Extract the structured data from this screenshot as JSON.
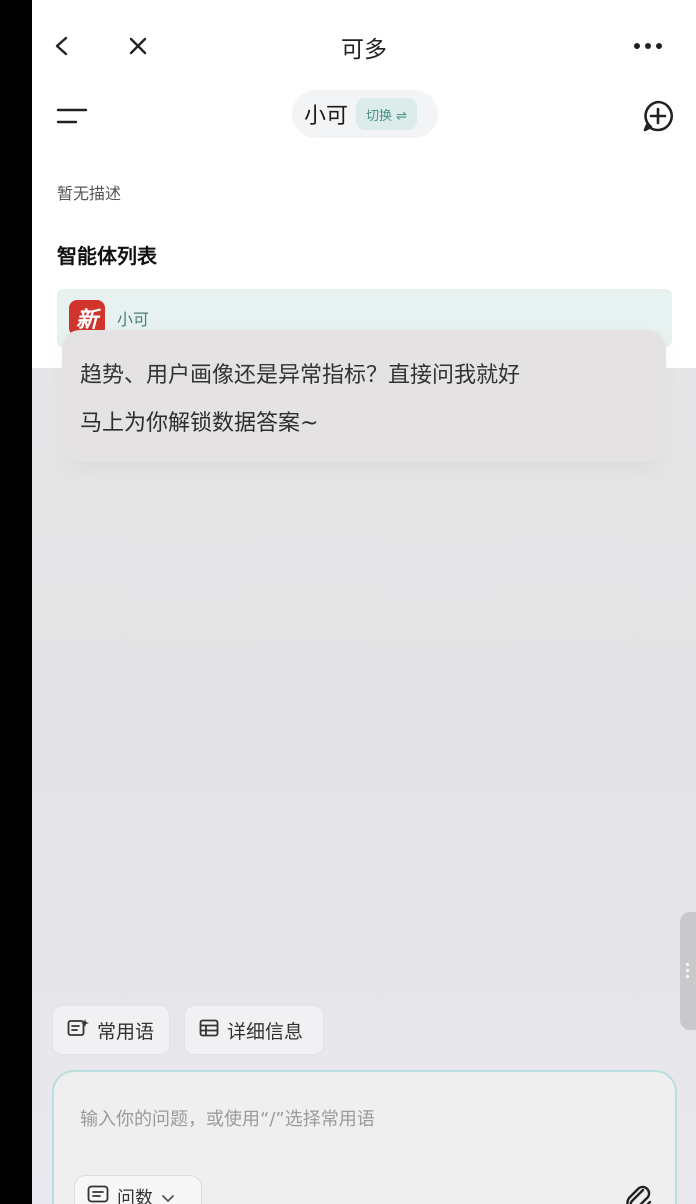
{
  "nav": {
    "title": "可多"
  },
  "agent": {
    "name": "小可",
    "switch_label": "切换 ⇌"
  },
  "panel": {
    "description": "暂无描述",
    "list_title": "智能体列表",
    "items": [
      {
        "logo_text": "新",
        "label": "小可"
      }
    ]
  },
  "chat": {
    "line1": "趋势、用户画像还是异常指标？直接问我就好",
    "line2": "马上为你解锁数据答案~"
  },
  "chips": [
    {
      "label": "常用语"
    },
    {
      "label": "详细信息"
    }
  ],
  "input": {
    "placeholder": "输入你的问题，或使用“/”选择常用语",
    "mode": "问数"
  },
  "colors": {
    "accent": "#4d8f89",
    "logo": "#d0342c"
  }
}
